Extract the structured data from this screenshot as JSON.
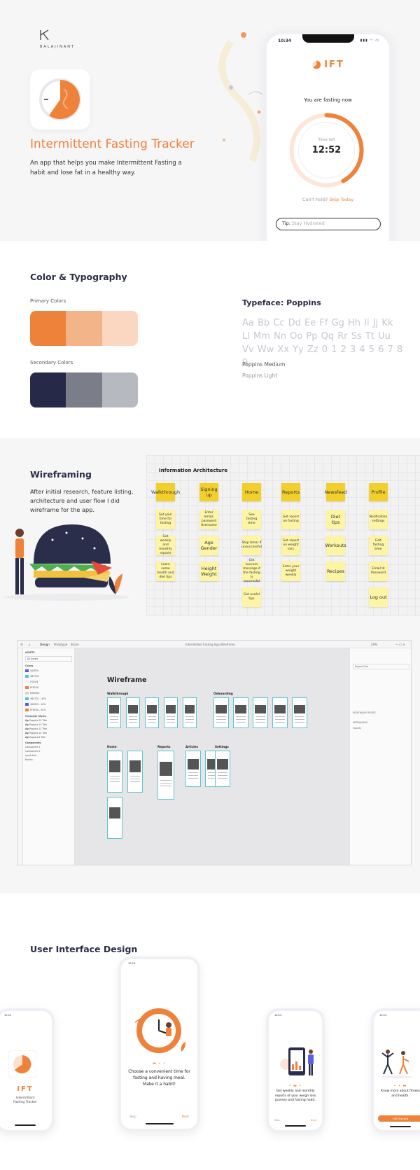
{
  "hero": {
    "brand": "BALAJINANT",
    "title": "Intermittent Fasting Tracker",
    "description": "An app that helps you make Intermittent Fasting a habit and lose fat in a healthy way.",
    "phone": {
      "status_time": "10:34",
      "status_icons": "▮▮▮ ◠ ▭",
      "logo_text": "IFT",
      "fasting_label": "You are fasting now",
      "time_left_label": "Time left",
      "time_left_value": "12:52",
      "progress_fraction": 0.42,
      "cant_hold": "Can't hold?",
      "skip_today": "Skip Today",
      "tip_label": "Tip:",
      "tip_value": "Stay Hydrated"
    }
  },
  "colors_section": {
    "title": "Color & Typography",
    "primary_label": "Primary Colors",
    "primary_colors": [
      "#ef823a",
      "#f4b48a",
      "#fbd7c1"
    ],
    "secondary_label": "Secondary Colors",
    "secondary_colors": [
      "#262a48",
      "#7b7d88",
      "#b7b9c0"
    ],
    "typeface_label": "Typeface: Poppins",
    "alphabet": "Aa Bb Cc Dd Ee Ff Gg Hh Ii Jj Kk Ll Mm Nn Oo Pp Qq Rr Ss Tt Uu Vv Ww Xx Yy Zz 0 1 2 3 4 5 6 7 8 9",
    "weight_medium": "Poppins Medium",
    "weight_light": "Poppins Light"
  },
  "wireframing": {
    "title": "Wireframing",
    "description": "After initial research, feature listing, architecture and user flow I did wireframe for the app.",
    "ia_title": "Information Architecture",
    "ia_columns": [
      {
        "head": "Walkthrough",
        "items": [
          "Set your time for fasting",
          "Get weekly and monthly reports",
          "Learn some health and diet tips"
        ]
      },
      {
        "head": "Signing up",
        "items": [
          "Enter email, password Username",
          "Age Gender",
          "Height Weight"
        ]
      },
      {
        "head": "Home",
        "items": [
          "See fasting time",
          "Stop timer if unsuccessful",
          "Get success message if the fasting is successful",
          "Get useful tips"
        ]
      },
      {
        "head": "Reports",
        "items": [
          "Get report on fasting",
          "Get report on weight loss",
          "Enter your weight weekly"
        ]
      },
      {
        "head": "Newsfeed",
        "items": [
          "Diet tips",
          "Workouts",
          "Recipes"
        ]
      },
      {
        "head": "Profile",
        "items": [
          "Notification settings",
          "Edit fasting time",
          "Email Id Password",
          "Log out"
        ]
      }
    ],
    "tool": {
      "tabs": [
        "Design",
        "Prototype",
        "Share"
      ],
      "doc_title": "Intermittent Fasting App Wireframe",
      "zoom": "29%",
      "assets_label": "ASSETS",
      "all_assets": "All Assets",
      "colors_label": "Colors",
      "swatches": [
        {
          "hex": "#5a5ee0",
          "name": "5A5EE0"
        },
        {
          "hex": "#4bc7d1",
          "name": "4BC7D1"
        },
        {
          "hex": "#f4f4f4",
          "name": "F4F4F4"
        },
        {
          "hex": "#ef823a",
          "name": "EF823A"
        },
        {
          "hex": "#d3d3d3",
          "name": "D3D3D3"
        },
        {
          "hex": "#4bc7d1",
          "name": "4BC7D1 - 40%"
        },
        {
          "hex": "#5a5ee0",
          "name": "5A5EE0 - 40%"
        },
        {
          "hex": "#ef823a",
          "name": "EF823A - 40%"
        }
      ],
      "char_styles_label": "Character Styles",
      "char_styles": [
        "Poppins 20 Title",
        "Poppins 14 Title",
        "Poppins 12 Title",
        "Poppins 10 Title",
        "Poppins 8 Title"
      ],
      "components_label": "Components",
      "components": [
        "Component 1",
        "Component 2",
        "Input field",
        "Button"
      ],
      "right_labels": [
        "Repeat Grid",
        "RESPONSIVE RESIZE",
        "APPEARANCE",
        "Opacity"
      ],
      "canvas_title": "Wireframe",
      "groups": [
        {
          "label": "Walkthrough"
        },
        {
          "label": "Onboarding"
        },
        {
          "label": "Home"
        },
        {
          "label": "Reports"
        },
        {
          "label": "Articles"
        },
        {
          "label": "Settings"
        }
      ]
    }
  },
  "ui_design": {
    "title": "User Interface Design",
    "phones": [
      {
        "status_time": "10:12",
        "logo_text": "IFT",
        "caption": "Intermittent Fasting Tracker"
      },
      {
        "status_time": "10:12",
        "caption": "Choose a convenient time for fasting and having meal. Make it a habit!",
        "left_action": "Skip",
        "right_action": "Next"
      },
      {
        "status_time": "10:12",
        "caption": "Get weekly and monthly reports of your weigh loss journey and fasting habit.",
        "left_action": "Skip",
        "right_action": "Next"
      },
      {
        "status_time": "10:12",
        "caption": "Know more about fitness and health.",
        "cta": "Get Started"
      }
    ]
  },
  "accent": "#ef823a"
}
